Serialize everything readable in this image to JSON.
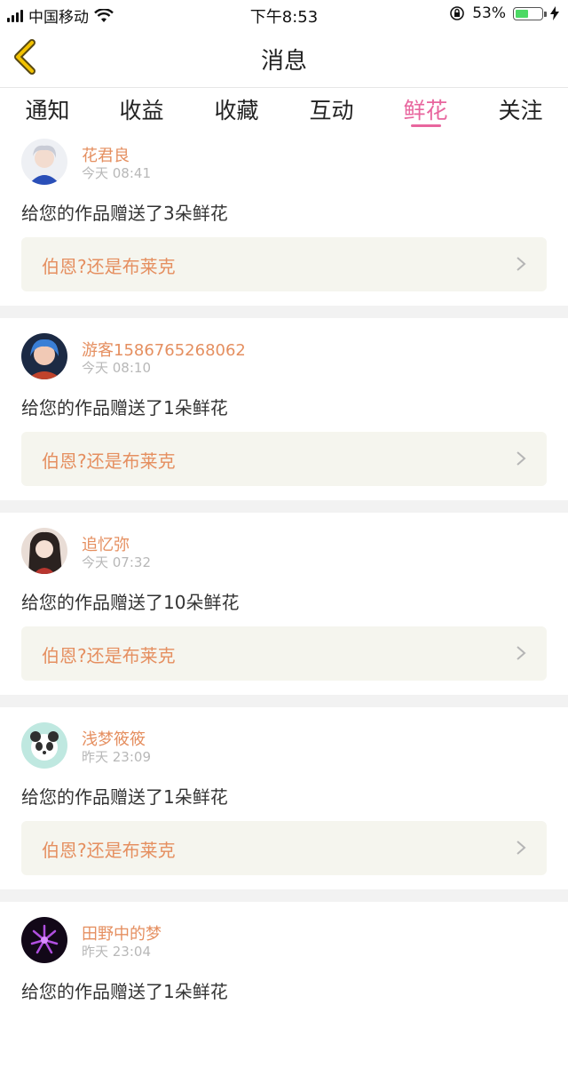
{
  "status_bar": {
    "carrier": "中国移动",
    "time": "下午8:53",
    "battery_percent": "53%",
    "battery_level": 0.53
  },
  "nav": {
    "title": "消息"
  },
  "tabs": [
    {
      "label": "通知",
      "active": false
    },
    {
      "label": "收益",
      "active": false
    },
    {
      "label": "收藏",
      "active": false
    },
    {
      "label": "互动",
      "active": false
    },
    {
      "label": "鲜花",
      "active": true
    },
    {
      "label": "关注",
      "active": false
    }
  ],
  "messages": [
    {
      "user": "花君良",
      "time": "今天 08:41",
      "text": "给您的作品赠送了3朵鲜花",
      "work": "伯恩?还是布莱克"
    },
    {
      "user": "游客1586765268062",
      "time": "今天 08:10",
      "text": "给您的作品赠送了1朵鲜花",
      "work": "伯恩?还是布莱克"
    },
    {
      "user": "追忆弥",
      "time": "今天 07:32",
      "text": "给您的作品赠送了10朵鲜花",
      "work": "伯恩?还是布莱克"
    },
    {
      "user": "浅梦筱筱",
      "time": "昨天 23:09",
      "text": "给您的作品赠送了1朵鲜花",
      "work": "伯恩?还是布莱克"
    },
    {
      "user": "田野中的梦",
      "time": "昨天 23:04",
      "text": "给您的作品赠送了1朵鲜花",
      "work": ""
    }
  ],
  "colors": {
    "accent_pink": "#e8669e",
    "username_orange": "#e58f60",
    "back_arrow_yellow": "#f2c200",
    "work_box_bg": "#f5f5ee"
  }
}
